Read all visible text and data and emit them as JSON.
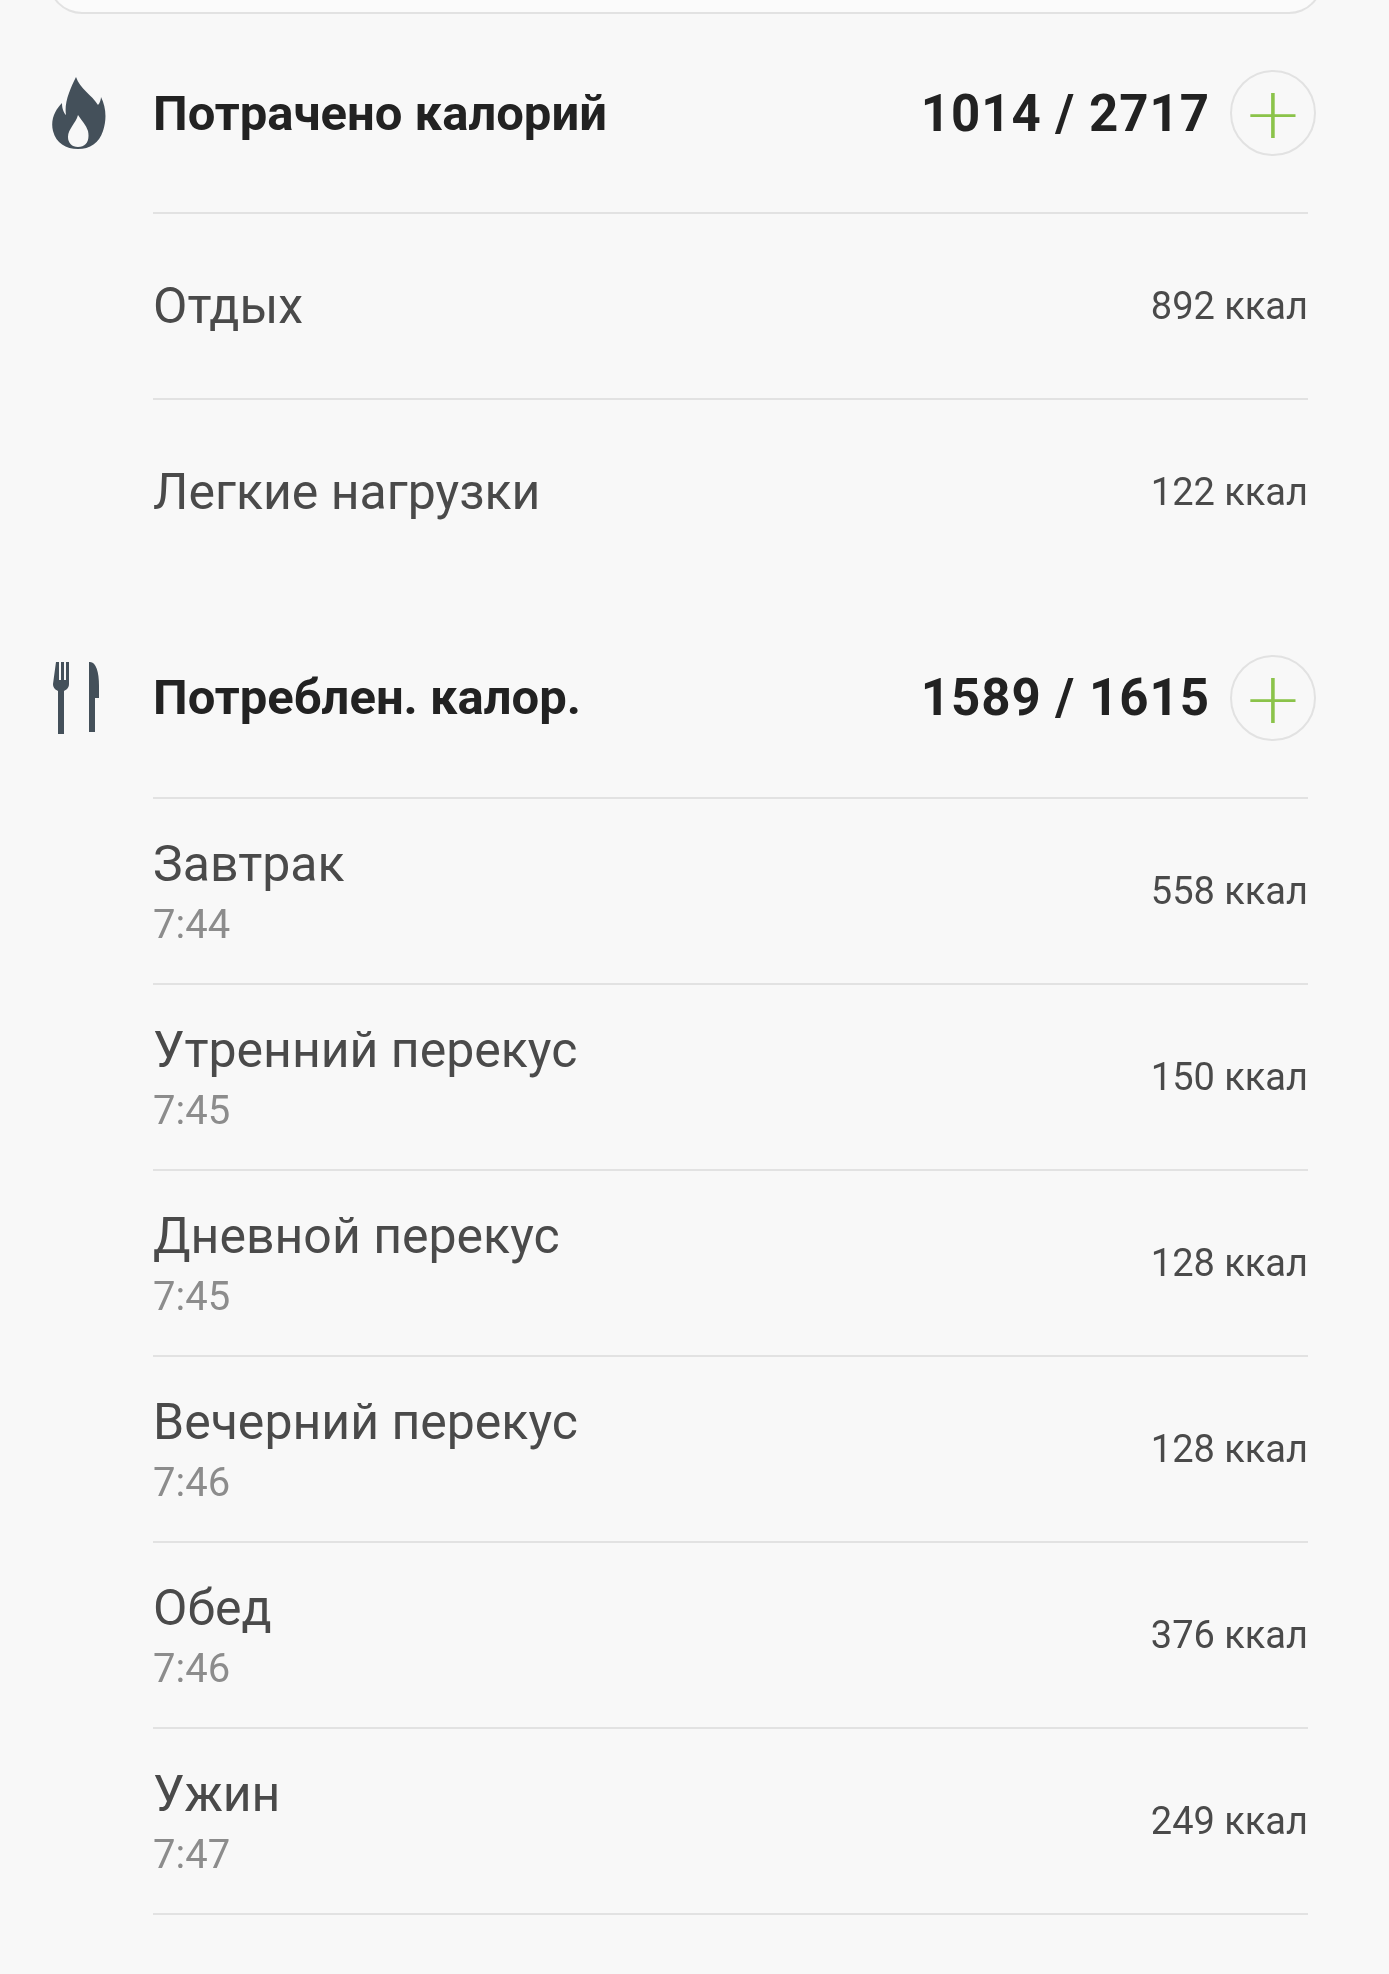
{
  "sections": [
    {
      "kind": "burned",
      "title": "Потрачено калорий",
      "total": "1014 / 2717",
      "add": "+",
      "items": [
        {
          "name": "Отдых",
          "value": "892 ккал"
        },
        {
          "name": "Легкие нагрузки",
          "value": "122 ккал"
        }
      ]
    },
    {
      "kind": "consumed",
      "title": "Потреблен. калор.",
      "total": "1589 / 1615",
      "add": "+",
      "items": [
        {
          "name": "Завтрак",
          "time": "7:44",
          "value": "558 ккал"
        },
        {
          "name": "Утренний перекус",
          "time": "7:45",
          "value": "150 ккал"
        },
        {
          "name": "Дневной перекус",
          "time": "7:45",
          "value": "128 ккал"
        },
        {
          "name": "Вечерний перекус",
          "time": "7:46",
          "value": "128 ккал"
        },
        {
          "name": "Обед",
          "time": "7:46",
          "value": "376 ккал"
        },
        {
          "name": "Ужин",
          "time": "7:47",
          "value": "249 ккал"
        }
      ]
    }
  ]
}
